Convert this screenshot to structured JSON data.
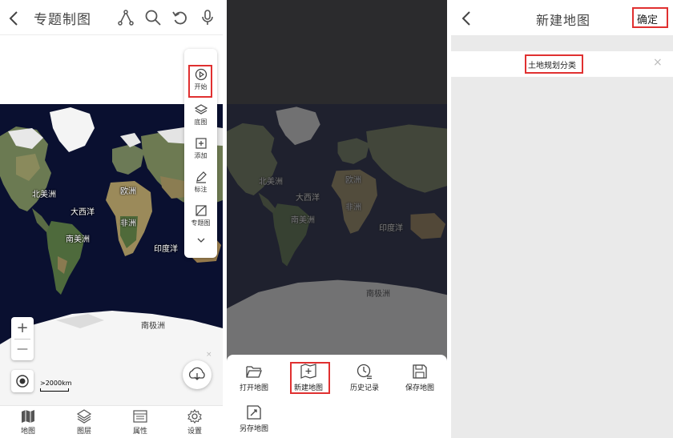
{
  "panel1": {
    "title": "专题制图",
    "tools": [
      "开始",
      "底图",
      "添加",
      "标注",
      "专题图"
    ],
    "zoom_in": "+",
    "zoom_out": "—",
    "scale": ">2000km",
    "fab_close": "×",
    "map_labels": [
      "北美洲",
      "欧洲",
      "大西洋",
      "非洲",
      "南美洲",
      "印度洋",
      "南极洲"
    ],
    "nav": [
      "地图",
      "图层",
      "属性",
      "设置"
    ]
  },
  "panel2": {
    "map_labels": [
      "北美洲",
      "欧洲",
      "大西洋",
      "非洲",
      "南美洲",
      "印度洋",
      "南极洲"
    ],
    "sheet_items": [
      "打开地图",
      "新建地图",
      "历史记录",
      "保存地图",
      "另存地图"
    ]
  },
  "panel3": {
    "title": "新建地图",
    "confirm": "确定",
    "field_value": "土地规划分类",
    "clear": "×"
  },
  "colors": {
    "highlight": "#e03030",
    "ocean": "#0a1030",
    "land": "#5a6b45",
    "ice": "#ffffff"
  }
}
